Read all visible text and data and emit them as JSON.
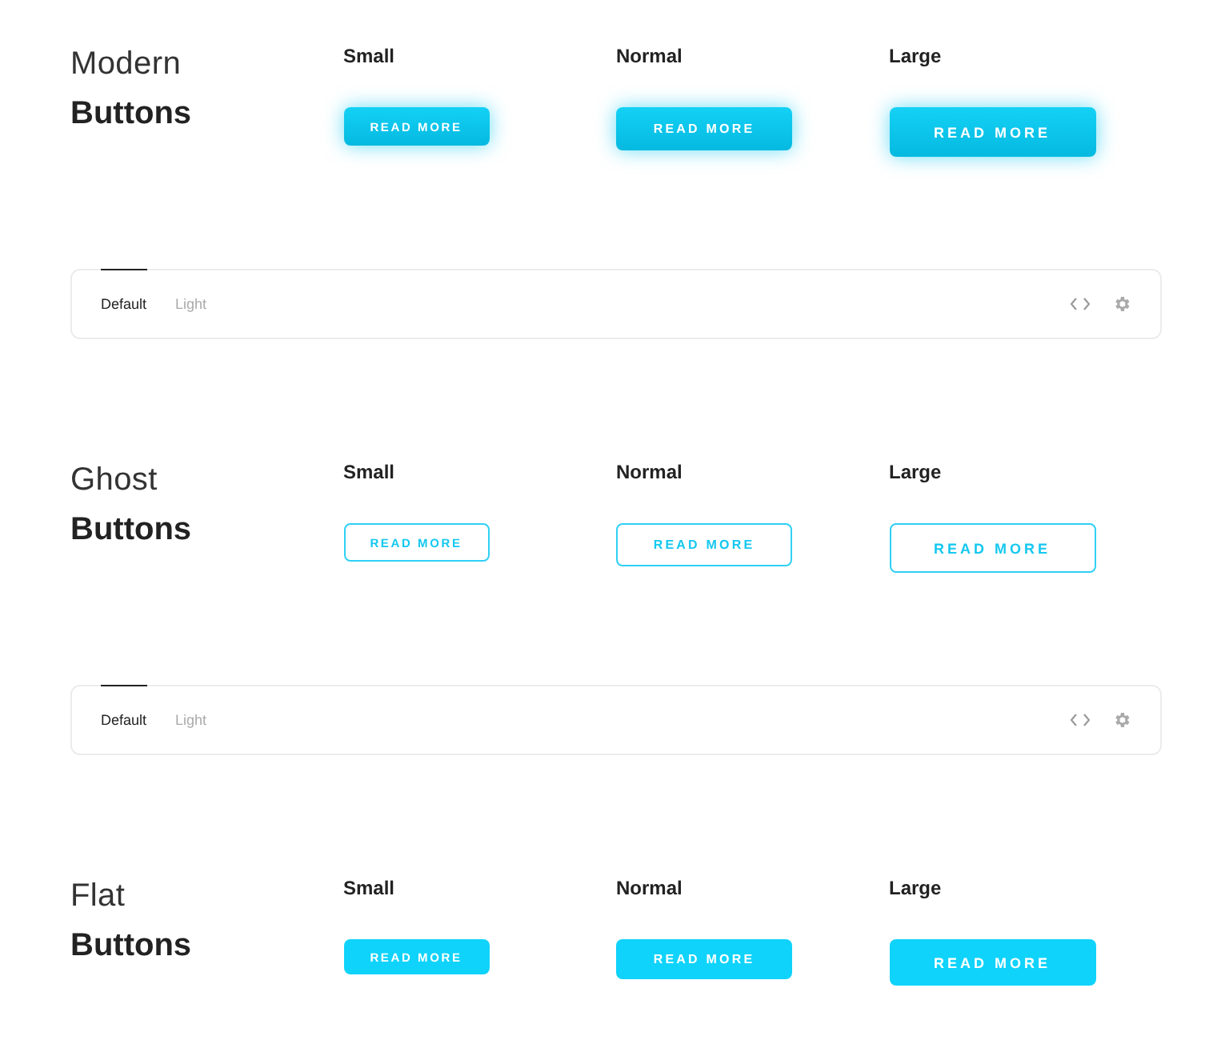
{
  "sections": [
    {
      "title_light": "Modern",
      "title_bold": "Buttons",
      "kind": "modern",
      "columns": [
        {
          "heading": "Small",
          "button": "READ MORE",
          "kind": "small"
        },
        {
          "heading": "Normal",
          "button": "READ MORE",
          "kind": "normal"
        },
        {
          "heading": "Large",
          "button": "READ MORE",
          "kind": "large"
        }
      ],
      "toolbar": {
        "tabs": [
          {
            "label": "Default",
            "selected": true
          },
          {
            "label": "Light",
            "selected": false
          }
        ]
      }
    },
    {
      "title_light": "Ghost",
      "title_bold": "Buttons",
      "kind": "ghost",
      "columns": [
        {
          "heading": "Small",
          "button": "READ MORE",
          "kind": "small"
        },
        {
          "heading": "Normal",
          "button": "READ MORE",
          "kind": "normal"
        },
        {
          "heading": "Large",
          "button": "READ MORE",
          "kind": "large"
        }
      ],
      "toolbar": {
        "tabs": [
          {
            "label": "Default",
            "selected": true
          },
          {
            "label": "Light",
            "selected": false
          }
        ]
      }
    },
    {
      "title_light": "Flat",
      "title_bold": "Buttons",
      "kind": "flat",
      "columns": [
        {
          "heading": "Small",
          "button": "READ MORE",
          "kind": "small"
        },
        {
          "heading": "Normal",
          "button": "READ MORE",
          "kind": "normal"
        },
        {
          "heading": "Large",
          "button": "READ MORE",
          "kind": "large"
        }
      ]
    }
  ]
}
